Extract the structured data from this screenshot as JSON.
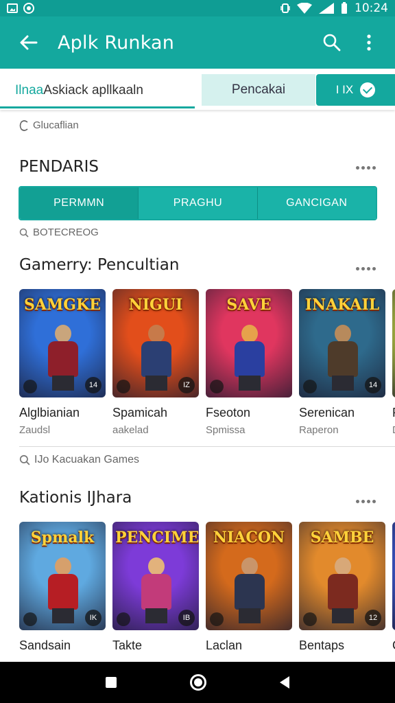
{
  "status_bar": {
    "time": "10:24"
  },
  "app_bar": {
    "title": "Aplk Runkan"
  },
  "tabs": {
    "main_prefix": "Ilnaa",
    "main_label": " Askiack apllkaaln",
    "search_tab": "Pencakai",
    "third_tab": "I  IX"
  },
  "filter_label": "Glucaflian",
  "section_category": {
    "title": "PENDARIS",
    "segments": [
      "PERMMN",
      "PRAGHU",
      "GANCIGAN"
    ]
  },
  "search_hint_1": "BOTECREOG",
  "section_games": {
    "title": "Gamerry: Pencultian",
    "items": [
      {
        "logo": "SAMGKE",
        "name": "Alglbianian",
        "sub": "Zaudsl",
        "badge": "14",
        "colors": [
          "#2f6fd8",
          "#8e1f2a",
          "#c9a57c"
        ]
      },
      {
        "logo": "NIGUI",
        "name": "Spamicah",
        "sub": "aakelad",
        "badge": "IZ",
        "colors": [
          "#e24e1b",
          "#2b3f73",
          "#c77a4a"
        ]
      },
      {
        "logo": "SAVE",
        "name": "Fseoton",
        "sub": "Spmissa",
        "badge": "",
        "colors": [
          "#e0365f",
          "#2a3fa0",
          "#e6a24b"
        ]
      },
      {
        "logo": "INAKAIL",
        "name": "Serenican",
        "sub": "Raperon",
        "badge": "14",
        "colors": [
          "#2e6a8c",
          "#4e3b2a",
          "#b78a5c"
        ]
      },
      {
        "logo": "",
        "name": "PB",
        "sub": "Dre",
        "badge": "",
        "colors": [
          "#b8c842",
          "#9d1b1f",
          "#d39a6a"
        ]
      }
    ]
  },
  "search_hint_2": "IJo Kacuakan Games",
  "section_more": {
    "title": "Kationis IJhara",
    "items": [
      {
        "logo": "Spmalk",
        "name": "Sandsain",
        "sub": "",
        "badge": "IK",
        "colors": [
          "#5fa9e0",
          "#b61e24",
          "#d6a06c"
        ]
      },
      {
        "logo": "PENCIME",
        "name": "Takte",
        "sub": "",
        "badge": "IB",
        "colors": [
          "#7d3bd8",
          "#c23b7a",
          "#e2b27c"
        ]
      },
      {
        "logo": "NIACON",
        "name": "Laclan",
        "sub": "",
        "badge": "",
        "colors": [
          "#d46a1c",
          "#2c3550",
          "#c9956a"
        ]
      },
      {
        "logo": "SAMBE",
        "name": "Bentaps",
        "sub": "",
        "badge": "12",
        "colors": [
          "#e28a2c",
          "#7c2a1f",
          "#d8a878"
        ]
      },
      {
        "logo": "",
        "name": "Ca",
        "sub": "",
        "badge": "",
        "colors": [
          "#3e5bd6",
          "#a0242a",
          "#d6a06c"
        ]
      }
    ]
  },
  "colors": {
    "primary": "#14a89e",
    "status": "#0f9d94",
    "tab_search_bg": "#d5f1ee"
  }
}
